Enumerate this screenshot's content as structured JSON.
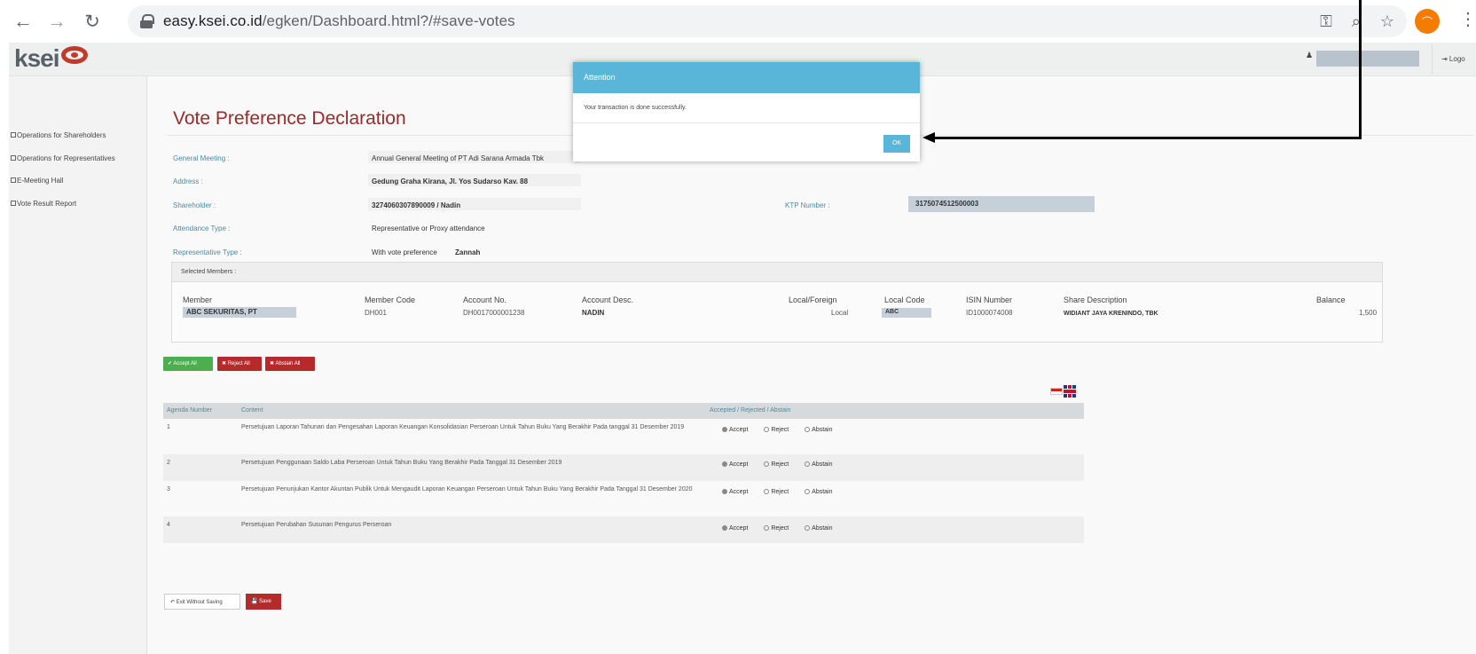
{
  "browser": {
    "url_host": "easy.ksei.co.id",
    "url_path": "/egken/Dashboard.html?/#save-votes",
    "icons": [
      "back-arrow-icon",
      "forward-arrow-icon",
      "reload-icon",
      "lock-icon",
      "key-icon",
      "zoom-icon",
      "star-icon",
      "profile-avatar",
      "kebab-menu-icon"
    ]
  },
  "header": {
    "logo_text": "ksei",
    "logout_label": "⇥ Logo"
  },
  "sidebar": {
    "items": [
      {
        "label": "Operations for Shareholders"
      },
      {
        "label": "Operations for Representatives"
      },
      {
        "label": "E-Meeting Hall"
      },
      {
        "label": "Vote Result Report"
      }
    ]
  },
  "page": {
    "title": "Vote Preference Declaration",
    "fields": {
      "general_meeting_label": "General Meeting :",
      "general_meeting_value": "Annual General Meeting of PT Adi Sarana Armada Tbk",
      "address_label": "Address :",
      "address_value": "Gedung Graha Kirana, Jl. Yos Sudarso Kav. 88",
      "shareholder_label": "Shareholder :",
      "shareholder_value": "3274060307890009 / Nadin",
      "ktp_label": "KTP Number :",
      "ktp_value": "3175074512500003",
      "attendance_type_label": "Attendance Type :",
      "attendance_type_value": "Representative or Proxy attendance",
      "representative_type_label": "Representative Type :",
      "representative_type_prefix": "With vote preference",
      "representative_type_value": "Zannah"
    },
    "members": {
      "panel_title": "Selected Members :",
      "headers": [
        "Member",
        "Member Code",
        "Account No.",
        "Account Desc.",
        "Local/Foreign",
        "Local Code",
        "ISIN Number",
        "Share Description",
        "Balance"
      ],
      "row": {
        "member": "ABC SEKURITAS, PT",
        "member_code": "DH001",
        "account_no": "DH0017000001238",
        "account_desc": "NADIN",
        "local_foreign": "Local",
        "local_code": "ABC",
        "isin": "ID1000074008",
        "share_desc": "WIDIANT JAYA KRENINDO, TBK",
        "balance": "1,500"
      }
    },
    "buttons": {
      "accept_all": "✔ Accept All",
      "reject_all": "✖ Reject All",
      "abstain_all": "✖ Abstain All",
      "exit": "↶ Exit Without Saving",
      "save": "💾 Save"
    },
    "agenda": {
      "headers": {
        "number": "Agenda Number",
        "content": "Content",
        "options": "Accepted / Rejected / Abstain"
      },
      "options": {
        "accept": "Accept",
        "reject": "Reject",
        "abstain": "Abstain"
      },
      "rows": [
        {
          "number": "1",
          "content": "Persetujuan Laporan Tahunan dan Pengesahan Laporan Keuangan Konsolidasian Perseroan Untuk Tahun Buku Yang Berakhir Pada tanggal 31 Desember 2019"
        },
        {
          "number": "2",
          "content": "Persetujuan Penggunaan Saldo Laba Perseroan Untuk Tahun Buku Yang Berakhir Pada Tanggal 31 Desember 2019"
        },
        {
          "number": "3",
          "content": "Persetujuan Penunjukan Kantor Akuntan Publik Untuk Mengaudit Laporan Keuangan Perseroan Untuk Tahun Buku Yang Berakhir Pada Tanggal 31 Desember 2020"
        },
        {
          "number": "4",
          "content": "Persetujuan Perubahan Susunan Pengurus Perseroan"
        }
      ]
    }
  },
  "modal": {
    "title": "Attention",
    "message": "Your transaction is done successfully.",
    "ok_label": "OK"
  },
  "colors": {
    "title_red": "#9b2a2a",
    "label_blue": "#4b8aa1",
    "modal_blue": "#5ab6d8",
    "accept_green": "#4cae4c",
    "reject_red": "#b52b2b"
  }
}
